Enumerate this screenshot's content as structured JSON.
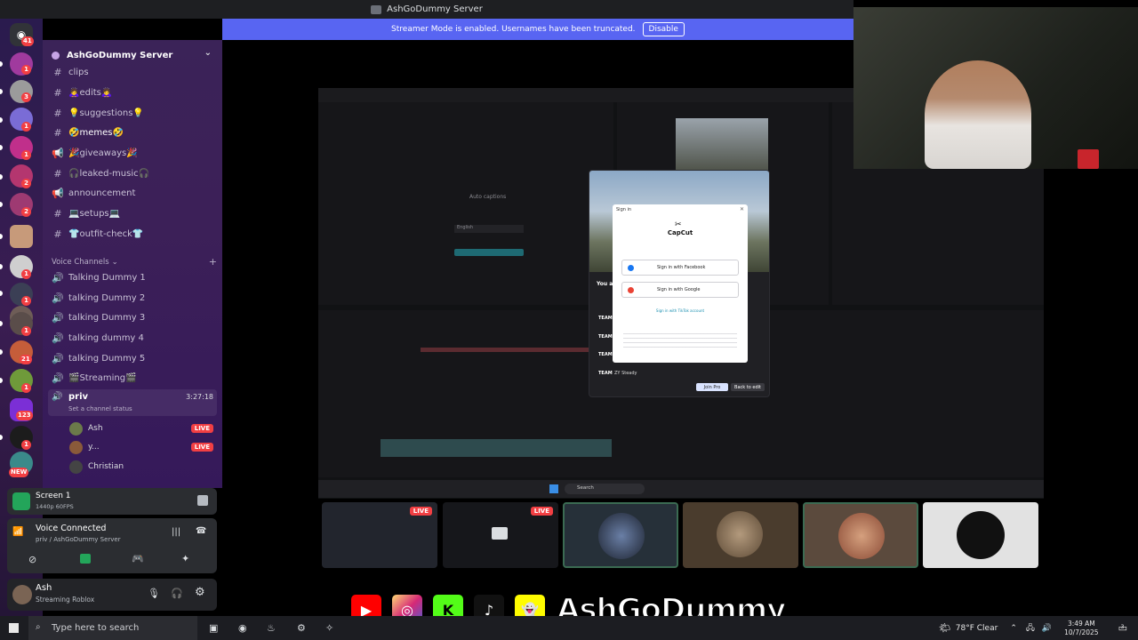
{
  "window": {
    "title": "AshGoDummy Server"
  },
  "banner": {
    "text": "Streamer Mode is enabled. Usernames have been truncated.",
    "button": "Disable"
  },
  "rail": {
    "badges": [
      "41",
      "1",
      "3",
      "1",
      "1",
      "2",
      "2",
      "1",
      "1",
      "173",
      "1",
      "21",
      "1",
      "123",
      "1",
      "NEW"
    ]
  },
  "server": {
    "name": "AshGoDummy Server"
  },
  "channels": [
    {
      "icon": "#",
      "label": "clips"
    },
    {
      "icon": "#",
      "label": "🙇‍♀️edits🙇‍♀️"
    },
    {
      "icon": "#",
      "label": "💡suggestions💡"
    },
    {
      "icon": "#",
      "label": "🤣memes🤣"
    },
    {
      "icon": "📢",
      "label": "🎉giveaways🎉"
    },
    {
      "icon": "#",
      "label": "🎧leaked-music🎧"
    },
    {
      "icon": "📢",
      "label": "announcement"
    },
    {
      "icon": "#",
      "label": "💻setups💻"
    },
    {
      "icon": "#",
      "label": "👕outfit-check👕"
    }
  ],
  "voice_section": {
    "label": "Voice Channels",
    "plus": "+"
  },
  "voice_channels": [
    "Talking Dummy 1",
    "talking Dummy 2",
    "talking Dummy 3",
    "talking dummy 4",
    "talking Dummy 5",
    "🎬Streaming🎬"
  ],
  "active_voice": {
    "name": "priv",
    "time": "3:27:18",
    "status": "Set a channel status"
  },
  "members": [
    {
      "name": "Ash",
      "live": "LIVE",
      "color": "#6b7a4a"
    },
    {
      "name": "y...",
      "live": "LIVE",
      "color": "#8a5a3a"
    },
    {
      "name": "Christian",
      "live": "",
      "color": "#444"
    }
  ],
  "screen_share": {
    "title": "Screen 1",
    "quality": "1440p 60FPS"
  },
  "voice_status": {
    "title": "Voice Connected",
    "sub": "priv / AshGoDummy Server"
  },
  "user": {
    "name": "Ash",
    "status": "Streaming Roblox"
  },
  "capcut": {
    "dialog_title": "Sign in",
    "logo": "CapCut",
    "facebook": "Sign in with Facebook",
    "google": "Sign in with Google",
    "tiktok": "Sign in with TikTok account",
    "join": "Join Pro",
    "back": "Back to edit",
    "auto_captions": "Auto captions",
    "language": "English",
    "team_prefix": "TEAM",
    "team_row": "ZY Steady",
    "you_label": "You a",
    "search": "Search"
  },
  "thumbnails": [
    {
      "live": "LIVE",
      "bg": "#22252d"
    },
    {
      "live": "LIVE",
      "bg": "#16171b"
    },
    {
      "live": "",
      "bg": "#263039"
    },
    {
      "live": "",
      "bg": "#4a3c2d"
    },
    {
      "live": "",
      "bg": "#5b4a3d"
    },
    {
      "live": "",
      "bg": "#e2e2e2"
    }
  ],
  "brand": {
    "text": "AshGoDummy"
  },
  "taskbar": {
    "search_placeholder": "Type here to search",
    "weather": "78°F  Clear",
    "time": "3:49 AM",
    "date": "10/7/2025",
    "notification_count": "3"
  }
}
